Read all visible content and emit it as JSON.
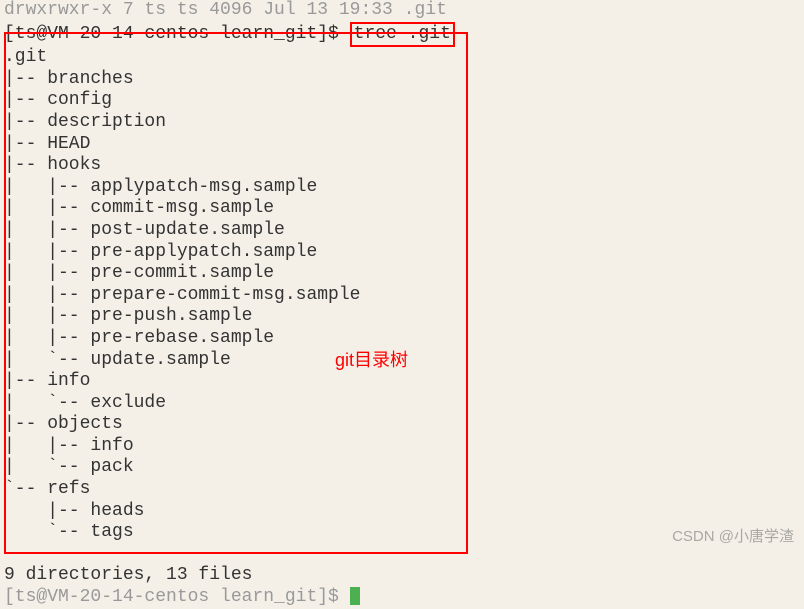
{
  "top_line": "drwxrwxr-x 7 ts ts 4096 Jul 13 19:33 .git",
  "prompt": "[ts@VM-20-14-centos learn_git]$ ",
  "command": "tree .git",
  "tree": {
    "root": ".git",
    "lines": [
      "|-- branches",
      "|-- config",
      "|-- description",
      "|-- HEAD",
      "|-- hooks",
      "|   |-- applypatch-msg.sample",
      "|   |-- commit-msg.sample",
      "|   |-- post-update.sample",
      "|   |-- pre-applypatch.sample",
      "|   |-- pre-commit.sample",
      "|   |-- prepare-commit-msg.sample",
      "|   |-- pre-push.sample",
      "|   |-- pre-rebase.sample",
      "|   `-- update.sample",
      "|-- info",
      "|   `-- exclude",
      "|-- objects",
      "|   |-- info",
      "|   `-- pack",
      "`-- refs",
      "    |-- heads",
      "    `-- tags"
    ],
    "summary": "9 directories, 13 files"
  },
  "bottom_prompt": "[ts@VM-20-14-centos learn_git]$ ",
  "annotation": "git目录树",
  "watermark": "CSDN @小唐学渣"
}
